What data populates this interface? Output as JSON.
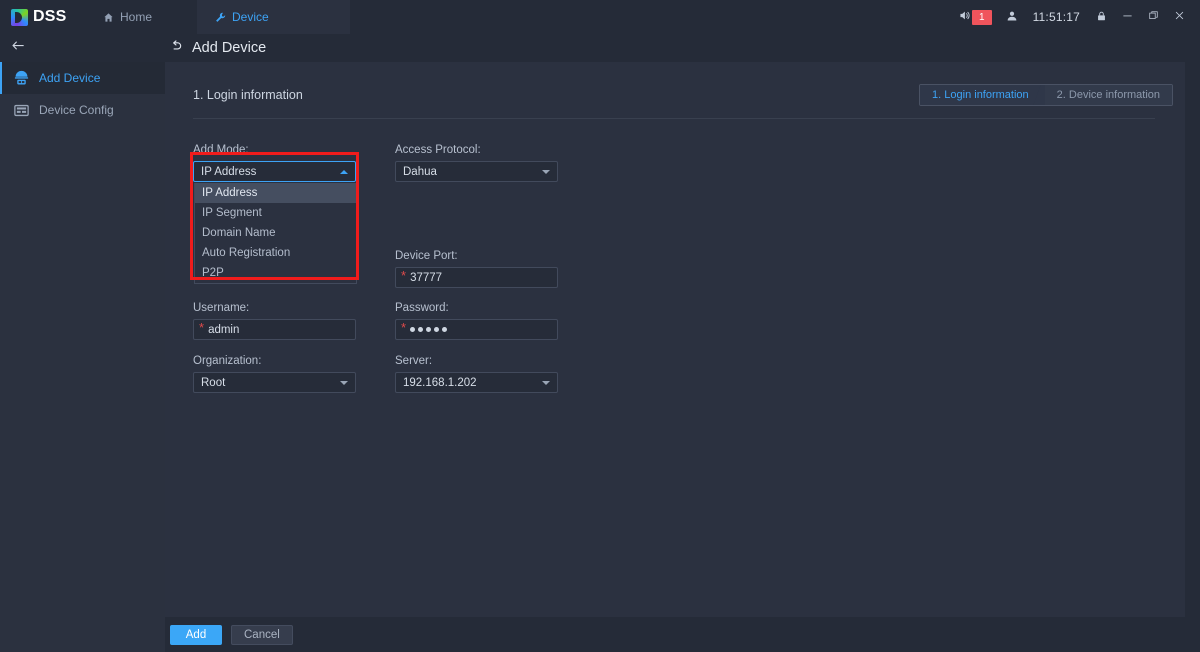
{
  "titlebar": {
    "logo_text": "DSS",
    "tabs": [
      {
        "label": "Home",
        "icon": "home-icon",
        "active": false
      },
      {
        "label": "Device",
        "icon": "wrench-icon",
        "active": true
      }
    ],
    "alarm_count": "1",
    "time": "11:51:17",
    "icons": [
      "speaker-icon",
      "user-icon",
      "lock-icon",
      "minimize-icon",
      "maximize-icon",
      "close-icon"
    ]
  },
  "subheader": {
    "back_icon": "back-arrow-icon",
    "title": "Add Device",
    "title_icon": "undo-arrow-icon"
  },
  "sidebar": {
    "items": [
      {
        "label": "Add Device",
        "icon": "camera-device-icon",
        "active": true
      },
      {
        "label": "Device Config",
        "icon": "server-rack-icon",
        "active": false
      }
    ]
  },
  "panel": {
    "section_title": "1. Login information",
    "steps": [
      {
        "label": "1. Login information",
        "active": true
      },
      {
        "label": "2. Device information",
        "active": false
      }
    ]
  },
  "form": {
    "add_mode": {
      "label": "Add Mode:",
      "value": "IP Address",
      "expanded": true,
      "options": [
        "IP Address",
        "IP Segment",
        "Domain Name",
        "Auto Registration",
        "P2P"
      ],
      "selected_index": 0
    },
    "access_protocol": {
      "label": "Access Protocol:",
      "value": "Dahua",
      "options": [
        "Dahua"
      ]
    },
    "device_port": {
      "label": "Device Port:",
      "value": "37777",
      "required": true
    },
    "username": {
      "label": "Username:",
      "value": "admin",
      "required": true
    },
    "password": {
      "label": "Password:",
      "value": "•••••",
      "masked_char_count": 5,
      "required": true
    },
    "organization": {
      "label": "Organization:",
      "value": "Root",
      "options": [
        "Root"
      ]
    },
    "server": {
      "label": "Server:",
      "value": "192.168.1.202",
      "options": [
        "192.168.1.202"
      ]
    }
  },
  "footer": {
    "add_label": "Add",
    "cancel_label": "Cancel"
  },
  "colors": {
    "accent": "#3da3f5",
    "primary_button": "#3ba7f7",
    "alarm_badge": "#f0545c",
    "highlight_box": "#f01c1c",
    "panel_bg": "#2b3140",
    "app_bg": "#252b38",
    "required_star": "#e04b4b"
  }
}
